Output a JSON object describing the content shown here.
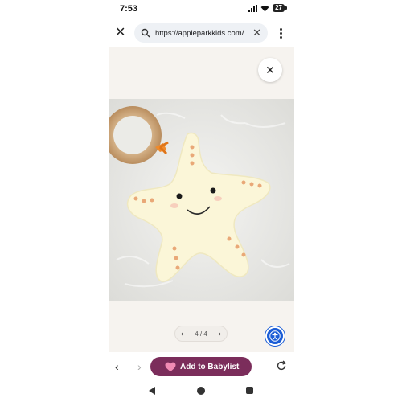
{
  "status_bar": {
    "time": "7:53",
    "battery": "27"
  },
  "browser": {
    "url": "https://appleparkkids.com/",
    "icons": [
      "close-icon",
      "search-icon",
      "clear-icon",
      "more-vert-icon"
    ]
  },
  "viewer": {
    "close_icon": "close-icon",
    "pager": {
      "current": "4",
      "total": "4",
      "label": "4 / 4"
    },
    "accessibility_icon": "accessibility-icon",
    "accent_color": "#1b5dd6"
  },
  "bottom_bar": {
    "add_button_label": "Add to Babylist",
    "button_color": "#7b2d5b",
    "icons": [
      "back-arrow-icon",
      "forward-arrow-icon",
      "heart-icon",
      "reload-icon"
    ]
  },
  "system_nav": {
    "icons": [
      "back-triangle-icon",
      "home-circle-icon",
      "recents-square-icon"
    ]
  }
}
